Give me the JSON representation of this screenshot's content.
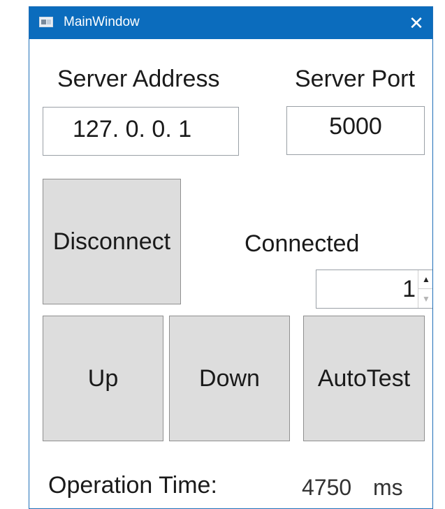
{
  "window": {
    "title": "MainWindow",
    "close_glyph": "✕"
  },
  "server": {
    "address_label": "Server Address",
    "address_value": "127.  0.  0.  1",
    "port_label": "Server Port",
    "port_value": "5000"
  },
  "connection": {
    "button_label": "Disconnect",
    "status_text": "Connected"
  },
  "spinner": {
    "value": "1",
    "up_glyph": "▲",
    "down_glyph": "▼"
  },
  "controls": {
    "up_label": "Up",
    "down_label": "Down",
    "autotest_label": "AutoTest"
  },
  "operation": {
    "label": "Operation Time:",
    "value": "4750",
    "unit": "ms"
  }
}
